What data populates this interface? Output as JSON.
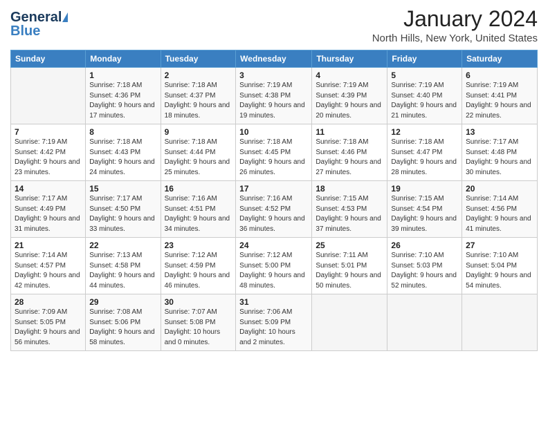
{
  "logo": {
    "line1": "General",
    "line2": "Blue"
  },
  "title": "January 2024",
  "subtitle": "North Hills, New York, United States",
  "days_of_week": [
    "Sunday",
    "Monday",
    "Tuesday",
    "Wednesday",
    "Thursday",
    "Friday",
    "Saturday"
  ],
  "weeks": [
    [
      {
        "day": "",
        "sunrise": "",
        "sunset": "",
        "daylight": ""
      },
      {
        "day": "1",
        "sunrise": "Sunrise: 7:18 AM",
        "sunset": "Sunset: 4:36 PM",
        "daylight": "Daylight: 9 hours and 17 minutes."
      },
      {
        "day": "2",
        "sunrise": "Sunrise: 7:18 AM",
        "sunset": "Sunset: 4:37 PM",
        "daylight": "Daylight: 9 hours and 18 minutes."
      },
      {
        "day": "3",
        "sunrise": "Sunrise: 7:19 AM",
        "sunset": "Sunset: 4:38 PM",
        "daylight": "Daylight: 9 hours and 19 minutes."
      },
      {
        "day": "4",
        "sunrise": "Sunrise: 7:19 AM",
        "sunset": "Sunset: 4:39 PM",
        "daylight": "Daylight: 9 hours and 20 minutes."
      },
      {
        "day": "5",
        "sunrise": "Sunrise: 7:19 AM",
        "sunset": "Sunset: 4:40 PM",
        "daylight": "Daylight: 9 hours and 21 minutes."
      },
      {
        "day": "6",
        "sunrise": "Sunrise: 7:19 AM",
        "sunset": "Sunset: 4:41 PM",
        "daylight": "Daylight: 9 hours and 22 minutes."
      }
    ],
    [
      {
        "day": "7",
        "sunrise": "Sunrise: 7:19 AM",
        "sunset": "Sunset: 4:42 PM",
        "daylight": "Daylight: 9 hours and 23 minutes."
      },
      {
        "day": "8",
        "sunrise": "Sunrise: 7:18 AM",
        "sunset": "Sunset: 4:43 PM",
        "daylight": "Daylight: 9 hours and 24 minutes."
      },
      {
        "day": "9",
        "sunrise": "Sunrise: 7:18 AM",
        "sunset": "Sunset: 4:44 PM",
        "daylight": "Daylight: 9 hours and 25 minutes."
      },
      {
        "day": "10",
        "sunrise": "Sunrise: 7:18 AM",
        "sunset": "Sunset: 4:45 PM",
        "daylight": "Daylight: 9 hours and 26 minutes."
      },
      {
        "day": "11",
        "sunrise": "Sunrise: 7:18 AM",
        "sunset": "Sunset: 4:46 PM",
        "daylight": "Daylight: 9 hours and 27 minutes."
      },
      {
        "day": "12",
        "sunrise": "Sunrise: 7:18 AM",
        "sunset": "Sunset: 4:47 PM",
        "daylight": "Daylight: 9 hours and 28 minutes."
      },
      {
        "day": "13",
        "sunrise": "Sunrise: 7:17 AM",
        "sunset": "Sunset: 4:48 PM",
        "daylight": "Daylight: 9 hours and 30 minutes."
      }
    ],
    [
      {
        "day": "14",
        "sunrise": "Sunrise: 7:17 AM",
        "sunset": "Sunset: 4:49 PM",
        "daylight": "Daylight: 9 hours and 31 minutes."
      },
      {
        "day": "15",
        "sunrise": "Sunrise: 7:17 AM",
        "sunset": "Sunset: 4:50 PM",
        "daylight": "Daylight: 9 hours and 33 minutes."
      },
      {
        "day": "16",
        "sunrise": "Sunrise: 7:16 AM",
        "sunset": "Sunset: 4:51 PM",
        "daylight": "Daylight: 9 hours and 34 minutes."
      },
      {
        "day": "17",
        "sunrise": "Sunrise: 7:16 AM",
        "sunset": "Sunset: 4:52 PM",
        "daylight": "Daylight: 9 hours and 36 minutes."
      },
      {
        "day": "18",
        "sunrise": "Sunrise: 7:15 AM",
        "sunset": "Sunset: 4:53 PM",
        "daylight": "Daylight: 9 hours and 37 minutes."
      },
      {
        "day": "19",
        "sunrise": "Sunrise: 7:15 AM",
        "sunset": "Sunset: 4:54 PM",
        "daylight": "Daylight: 9 hours and 39 minutes."
      },
      {
        "day": "20",
        "sunrise": "Sunrise: 7:14 AM",
        "sunset": "Sunset: 4:56 PM",
        "daylight": "Daylight: 9 hours and 41 minutes."
      }
    ],
    [
      {
        "day": "21",
        "sunrise": "Sunrise: 7:14 AM",
        "sunset": "Sunset: 4:57 PM",
        "daylight": "Daylight: 9 hours and 42 minutes."
      },
      {
        "day": "22",
        "sunrise": "Sunrise: 7:13 AM",
        "sunset": "Sunset: 4:58 PM",
        "daylight": "Daylight: 9 hours and 44 minutes."
      },
      {
        "day": "23",
        "sunrise": "Sunrise: 7:12 AM",
        "sunset": "Sunset: 4:59 PM",
        "daylight": "Daylight: 9 hours and 46 minutes."
      },
      {
        "day": "24",
        "sunrise": "Sunrise: 7:12 AM",
        "sunset": "Sunset: 5:00 PM",
        "daylight": "Daylight: 9 hours and 48 minutes."
      },
      {
        "day": "25",
        "sunrise": "Sunrise: 7:11 AM",
        "sunset": "Sunset: 5:01 PM",
        "daylight": "Daylight: 9 hours and 50 minutes."
      },
      {
        "day": "26",
        "sunrise": "Sunrise: 7:10 AM",
        "sunset": "Sunset: 5:03 PM",
        "daylight": "Daylight: 9 hours and 52 minutes."
      },
      {
        "day": "27",
        "sunrise": "Sunrise: 7:10 AM",
        "sunset": "Sunset: 5:04 PM",
        "daylight": "Daylight: 9 hours and 54 minutes."
      }
    ],
    [
      {
        "day": "28",
        "sunrise": "Sunrise: 7:09 AM",
        "sunset": "Sunset: 5:05 PM",
        "daylight": "Daylight: 9 hours and 56 minutes."
      },
      {
        "day": "29",
        "sunrise": "Sunrise: 7:08 AM",
        "sunset": "Sunset: 5:06 PM",
        "daylight": "Daylight: 9 hours and 58 minutes."
      },
      {
        "day": "30",
        "sunrise": "Sunrise: 7:07 AM",
        "sunset": "Sunset: 5:08 PM",
        "daylight": "Daylight: 10 hours and 0 minutes."
      },
      {
        "day": "31",
        "sunrise": "Sunrise: 7:06 AM",
        "sunset": "Sunset: 5:09 PM",
        "daylight": "Daylight: 10 hours and 2 minutes."
      },
      {
        "day": "",
        "sunrise": "",
        "sunset": "",
        "daylight": ""
      },
      {
        "day": "",
        "sunrise": "",
        "sunset": "",
        "daylight": ""
      },
      {
        "day": "",
        "sunrise": "",
        "sunset": "",
        "daylight": ""
      }
    ]
  ]
}
